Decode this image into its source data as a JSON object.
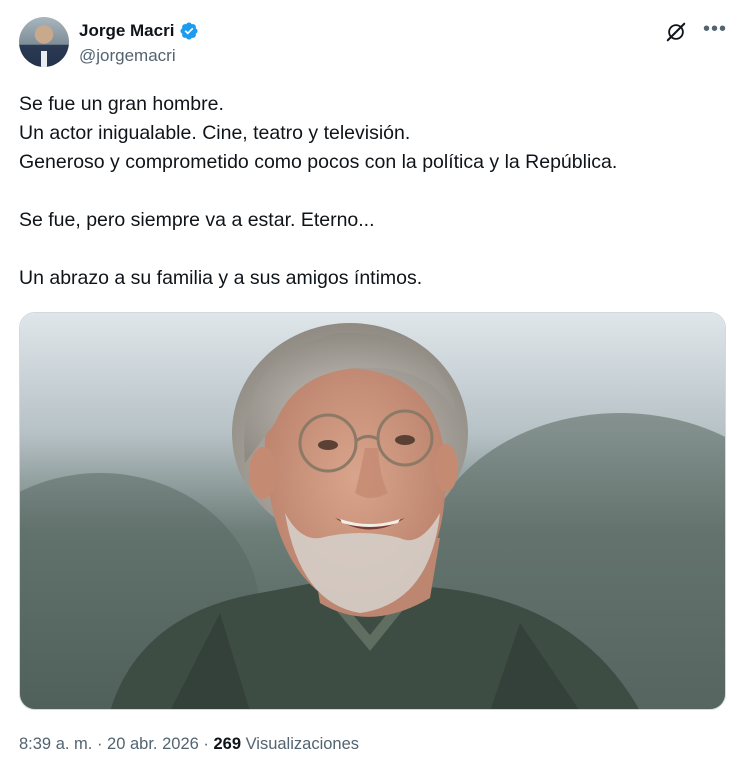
{
  "author": {
    "name": "Jorge Macri",
    "handle": "@jorgemacri",
    "verified": true,
    "verified_color": "#1d9bf0"
  },
  "icons": {
    "grok": "grok-icon",
    "more": "more-options-icon"
  },
  "tweet": {
    "lines": [
      "Se fue un gran hombre.",
      "Un actor inigualable. Cine, teatro y televisión.",
      "Generoso y comprometido como pocos con la política y la República.",
      "Se fue, pero siempre va a estar. Eterno...",
      "Un abrazo a su familia y a sus amigos íntimos."
    ]
  },
  "meta": {
    "time": "8:39 a. m.",
    "sep1": " · ",
    "date": "20 abr. 2026",
    "sep2": " · ",
    "views_count": "269",
    "views_label": " Visualizaciones"
  }
}
